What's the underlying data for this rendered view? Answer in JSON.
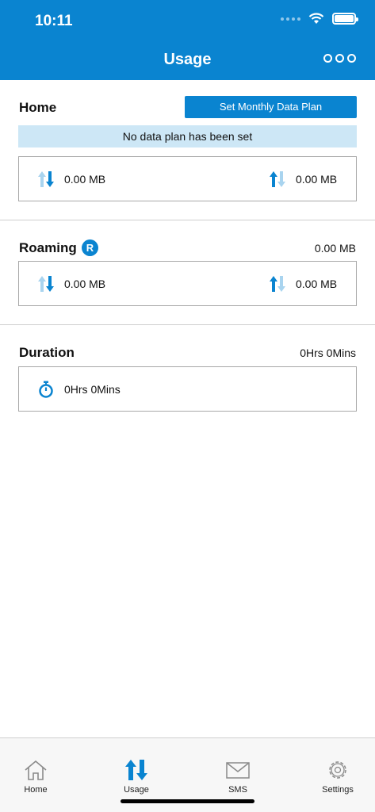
{
  "status_bar": {
    "time": "10:11"
  },
  "header": {
    "title": "Usage",
    "more_icon": "more-icon"
  },
  "home": {
    "title": "Home",
    "plan_button": "Set Monthly Data Plan",
    "plan_notice": "No data plan has been set",
    "download": "0.00 MB",
    "upload": "0.00 MB"
  },
  "roaming": {
    "title": "Roaming",
    "badge": "R",
    "total": "0.00 MB",
    "download": "0.00 MB",
    "upload": "0.00 MB"
  },
  "duration": {
    "title": "Duration",
    "total": "0Hrs 0Mins",
    "value": "0Hrs 0Mins"
  },
  "tabs": [
    {
      "label": "Home",
      "icon": "home-icon"
    },
    {
      "label": "Usage",
      "icon": "usage-arrows-icon",
      "active": true
    },
    {
      "label": "SMS",
      "icon": "envelope-icon"
    },
    {
      "label": "Settings",
      "icon": "gear-icon"
    }
  ],
  "colors": {
    "accent": "#0a84d0",
    "light_accent": "#cde7f6",
    "arrow_light": "#a9d4ef"
  }
}
